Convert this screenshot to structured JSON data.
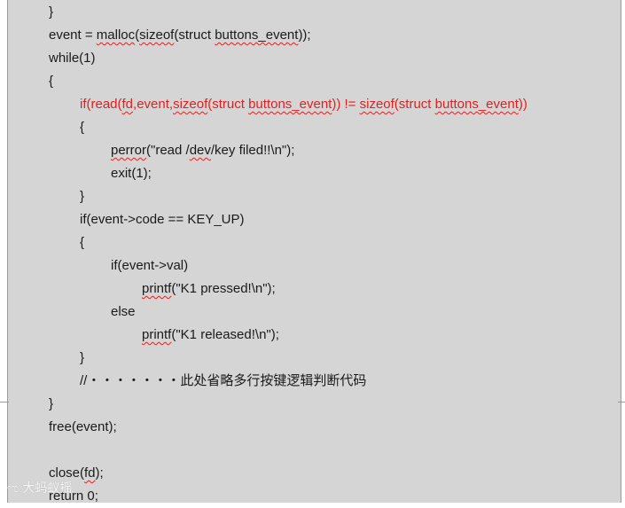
{
  "code": {
    "lines": [
      {
        "indent": 0,
        "color": "default",
        "segments": [
          {
            "text": "}"
          }
        ]
      },
      {
        "indent": 0,
        "color": "default",
        "segments": [
          {
            "text": "event = "
          },
          {
            "text": "malloc",
            "squiggle": true
          },
          {
            "text": "("
          },
          {
            "text": "sizeof",
            "squiggle": true
          },
          {
            "text": "(struct "
          },
          {
            "text": "buttons_event",
            "squiggle": true
          },
          {
            "text": "));"
          }
        ]
      },
      {
        "indent": 0,
        "color": "default",
        "segments": [
          {
            "text": "while(1)"
          }
        ]
      },
      {
        "indent": 0,
        "color": "default",
        "segments": [
          {
            "text": "{"
          }
        ]
      },
      {
        "indent": 1,
        "color": "red",
        "segments": [
          {
            "text": "if(read("
          },
          {
            "text": "fd",
            "squiggle": true
          },
          {
            "text": ",event,"
          },
          {
            "text": "sizeof",
            "squiggle": true
          },
          {
            "text": "(struct "
          },
          {
            "text": "buttons_event",
            "squiggle": true
          },
          {
            "text": ")) != "
          },
          {
            "text": "sizeof",
            "squiggle": true
          },
          {
            "text": "(struct "
          },
          {
            "text": "buttons_event",
            "squiggle": true
          },
          {
            "text": "))"
          }
        ]
      },
      {
        "indent": 1,
        "color": "default",
        "segments": [
          {
            "text": "{"
          }
        ]
      },
      {
        "indent": 2,
        "color": "default",
        "segments": [
          {
            "text": "perror",
            "squiggle": true
          },
          {
            "text": "(\"read /"
          },
          {
            "text": "dev",
            "squiggle": true
          },
          {
            "text": "/key filed!!\\n\");"
          }
        ]
      },
      {
        "indent": 2,
        "color": "default",
        "segments": [
          {
            "text": "exit(1);"
          }
        ]
      },
      {
        "indent": 1,
        "color": "default",
        "segments": [
          {
            "text": "}"
          }
        ]
      },
      {
        "indent": 1,
        "color": "default",
        "segments": [
          {
            "text": "if(event->code == KEY_UP)"
          }
        ]
      },
      {
        "indent": 1,
        "color": "default",
        "segments": [
          {
            "text": "{"
          }
        ]
      },
      {
        "indent": 2,
        "color": "default",
        "segments": [
          {
            "text": "if(event->val)"
          }
        ]
      },
      {
        "indent": 3,
        "color": "default",
        "segments": [
          {
            "text": "printf",
            "squiggle": true
          },
          {
            "text": "(\"K1 pressed!\\n\");"
          }
        ]
      },
      {
        "indent": 2,
        "color": "default",
        "segments": [
          {
            "text": "else"
          }
        ]
      },
      {
        "indent": 3,
        "color": "default",
        "segments": [
          {
            "text": "printf",
            "squiggle": true
          },
          {
            "text": "(\"K1 released!\\n\");"
          }
        ]
      },
      {
        "indent": 1,
        "color": "default",
        "segments": [
          {
            "text": "}"
          }
        ]
      },
      {
        "indent": 1,
        "color": "default",
        "segments": [
          {
            "text": "//・・・・・・・此处省略多行按键逻辑判断代码"
          }
        ]
      },
      {
        "indent": 0,
        "color": "default",
        "segments": [
          {
            "text": "}"
          }
        ]
      },
      {
        "indent": 0,
        "color": "default",
        "segments": [
          {
            "text": "free(event);"
          }
        ]
      },
      {
        "indent": 0,
        "color": "default",
        "segments": [
          {
            "text": ""
          }
        ]
      },
      {
        "indent": 0,
        "color": "default",
        "segments": [
          {
            "text": "close("
          },
          {
            "text": "fd",
            "squiggle": true
          },
          {
            "text": ");"
          }
        ]
      },
      {
        "indent": 0,
        "color": "default",
        "segments": [
          {
            "text": "return 0;"
          }
        ]
      }
    ]
  },
  "colors": {
    "page_background": "#d5d5d5",
    "text": "#1a1a1a",
    "highlight_red": "#e02020",
    "spellcheck_squiggle": "#e02020"
  },
  "watermark": {
    "icon": "weibo-logo-icon",
    "text": "大蚂蚁摇"
  }
}
